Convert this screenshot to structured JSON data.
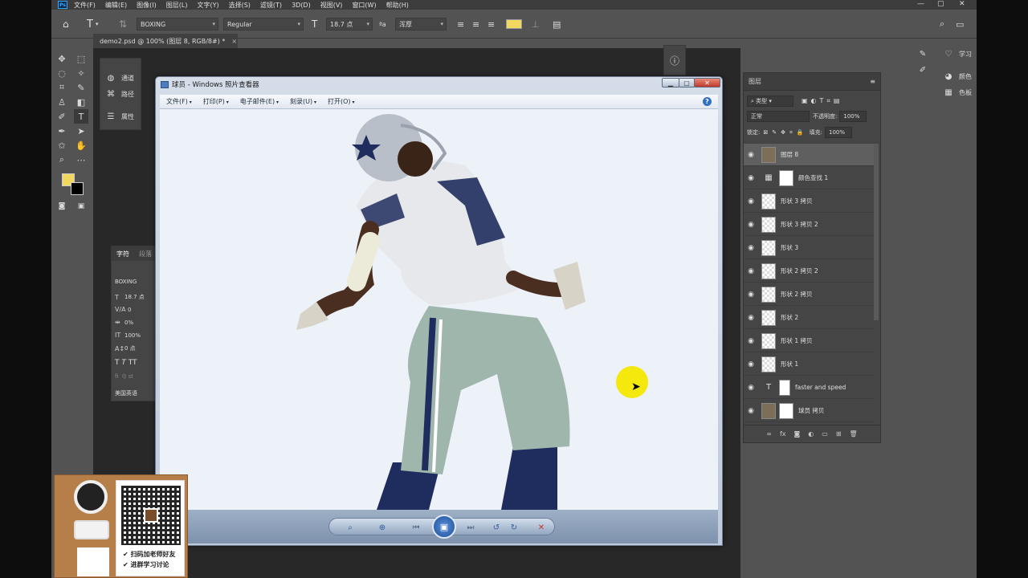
{
  "menubar": {
    "items": [
      "文件(F)",
      "编辑(E)",
      "图像(I)",
      "图层(L)",
      "文字(Y)",
      "选择(S)",
      "滤镜(T)",
      "3D(D)",
      "视图(V)",
      "窗口(W)",
      "帮助(H)"
    ]
  },
  "options": {
    "font_family": "BOXING",
    "font_style": "Regular",
    "font_size": "18.7 点",
    "antialias": "浑厚",
    "color": "#f2d860"
  },
  "document_tab": {
    "title": "demo2.psd @ 100% (图层 8, RGB/8#) *",
    "close": "×"
  },
  "mini_panel": {
    "items": [
      {
        "label": "通道",
        "icon": "channels-icon"
      },
      {
        "label": "路径",
        "icon": "paths-icon"
      },
      {
        "label": "属性",
        "icon": "properties-icon"
      }
    ]
  },
  "character_panel": {
    "tab_active": "字符",
    "tab_other": "段落",
    "font": "BOXING",
    "size": "18.7 点",
    "kerning": "0",
    "tracking": "0%",
    "vertical_scale": "100%",
    "baseline": "0 点",
    "language": "美国英语"
  },
  "right_column": {
    "learn": "学习",
    "color": "颜色",
    "swatches": "色板"
  },
  "layers_panel": {
    "title": "图层",
    "filter": "类型",
    "blend_mode": "正常",
    "opacity_label": "不透明度:",
    "opacity": "100%",
    "lock_label": "锁定:",
    "fill_label": "填充:",
    "fill": "100%",
    "layers": [
      {
        "name": "图层 8",
        "kind": "photo",
        "selected": true
      },
      {
        "name": "颜色查找 1",
        "kind": "adjustment",
        "selected": false
      },
      {
        "name": "形状 3 拷贝",
        "kind": "shape",
        "selected": false
      },
      {
        "name": "形状 3 拷贝 2",
        "kind": "shape",
        "selected": false
      },
      {
        "name": "形状 3",
        "kind": "shape",
        "selected": false
      },
      {
        "name": "形状 2 拷贝 2",
        "kind": "shape",
        "selected": false
      },
      {
        "name": "形状 2 拷贝",
        "kind": "shape",
        "selected": false
      },
      {
        "name": "形状 2",
        "kind": "shape",
        "selected": false
      },
      {
        "name": "形状 1 拷贝",
        "kind": "shape",
        "selected": false
      },
      {
        "name": "形状 1",
        "kind": "shape",
        "selected": false
      },
      {
        "name": "faster and speed",
        "kind": "text",
        "selected": false
      },
      {
        "name": "球员 拷贝",
        "kind": "photo",
        "selected": false
      }
    ]
  },
  "photo_viewer": {
    "title": "球员 - Windows 照片查看器",
    "menus": [
      "文件(F)",
      "打印(P)",
      "电子邮件(E)",
      "刻录(U)",
      "打开(O)"
    ],
    "help": "?"
  },
  "promo": {
    "line1": "✔ 扫码加老师好友",
    "line2": "✔ 进群学习讨论"
  }
}
